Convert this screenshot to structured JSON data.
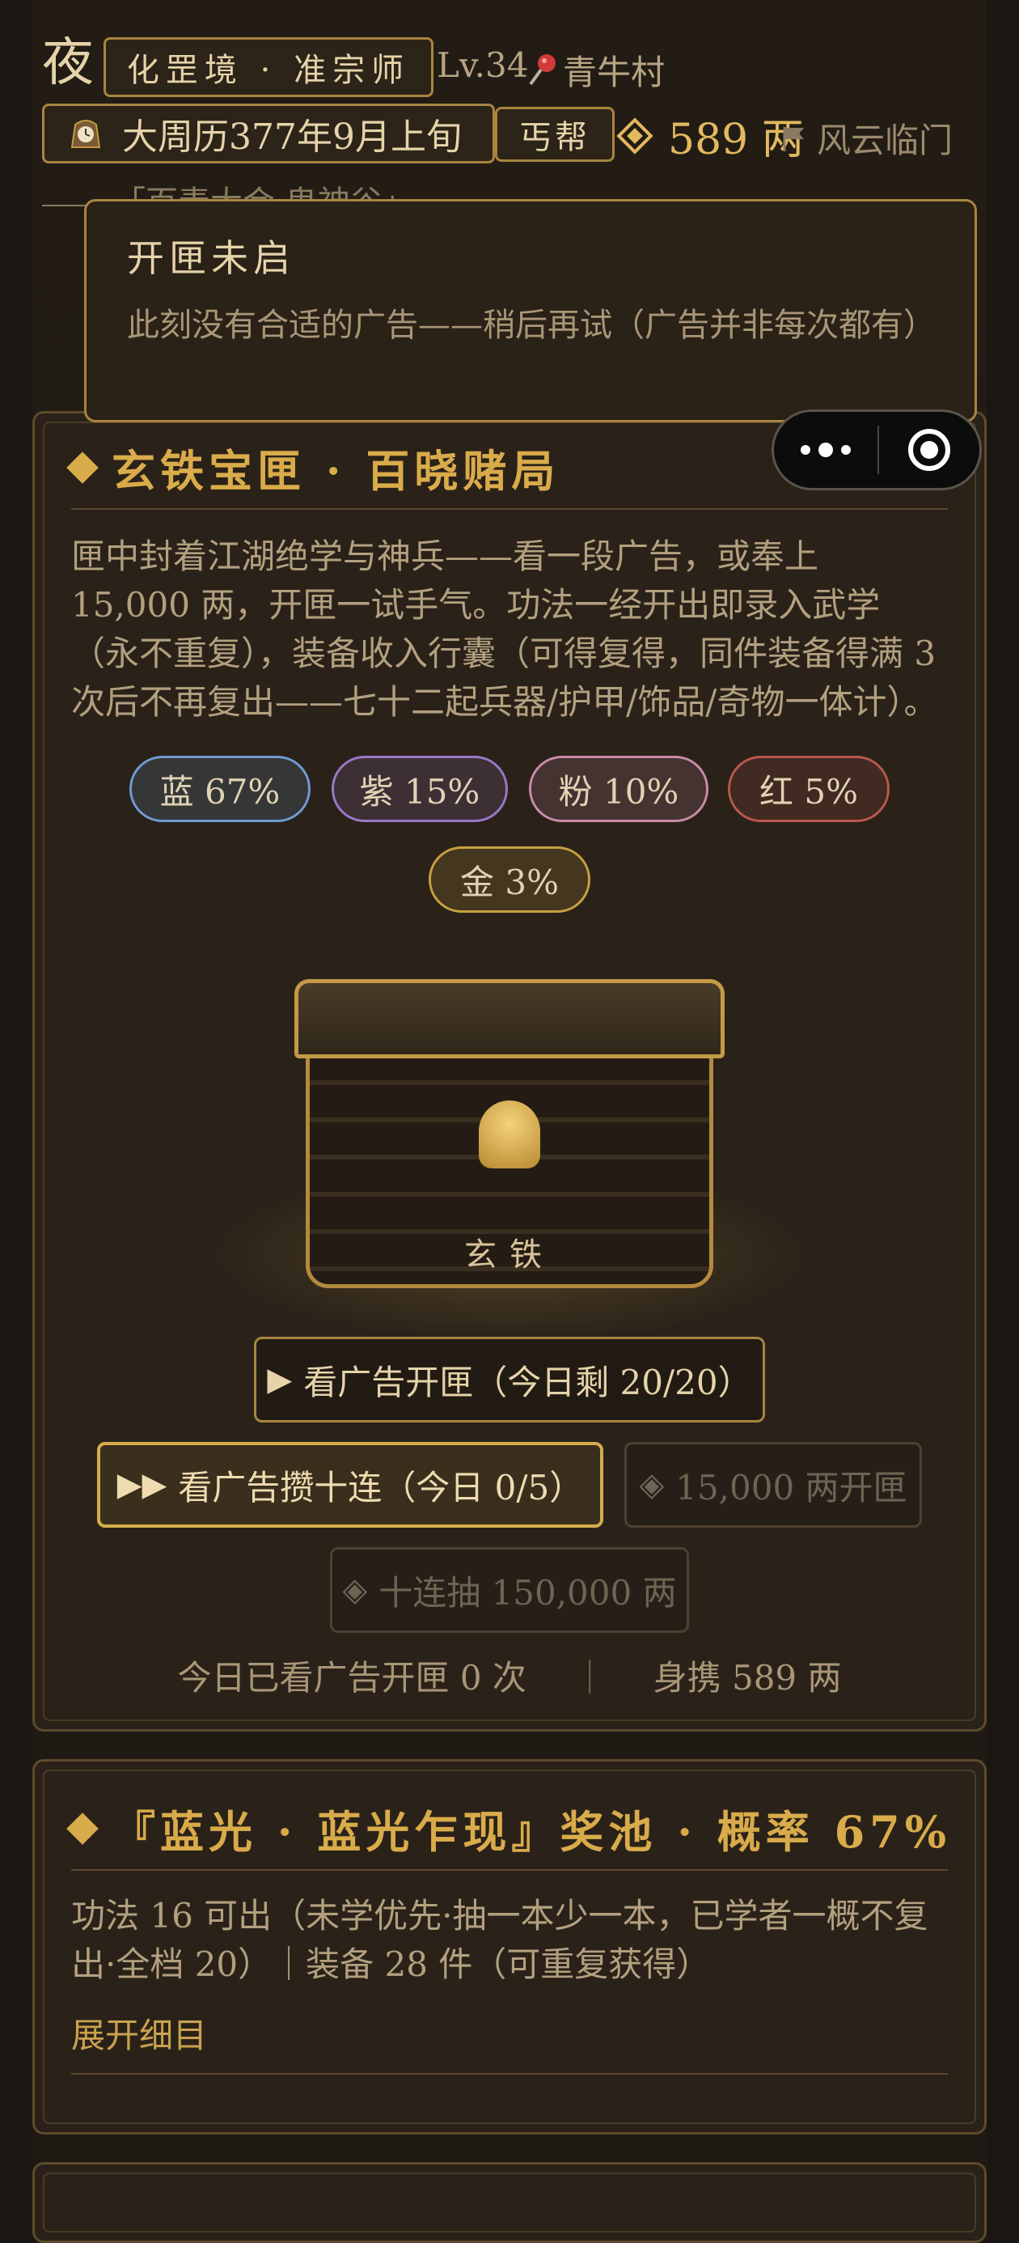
{
  "header": {
    "time_of_day": "夜",
    "realm": "化罡境 · 准宗师",
    "level": "Lv.34",
    "location": "青牛村",
    "date": "大周历377年9月上旬",
    "gang": "丐帮",
    "silver": "589 两",
    "faction": "风云临门",
    "notice": "「百毒大会·鬼神谷」"
  },
  "toast": {
    "title": "开匣未启",
    "message": "此刻没有合适的广告——稍后再试（广告并非每次都有）"
  },
  "capsule": {
    "more_icon": "more-dots-icon",
    "close_icon": "target-circle-icon"
  },
  "chest_panel": {
    "title": "玄铁宝匣 · 百晓赌局",
    "description": "匣中封着江湖绝学与神兵——看一段广告，或奉上 15,000 两，开匣一试手气。功法一经开出即录入武学（永不重复），装备收入行囊（可得复得，同件装备得满 3 次后不再复出——七十二起兵器/护甲/饰品/奇物一体计）。",
    "rates": [
      {
        "label": "蓝 67%",
        "color": "#6f9bd1"
      },
      {
        "label": "紫 15%",
        "color": "#9a78c8"
      },
      {
        "label": "粉 10%",
        "color": "#c98aa8"
      },
      {
        "label": "红 5%",
        "color": "#b8584e"
      },
      {
        "label": "金 3%",
        "color": "#c7a040"
      }
    ],
    "chest_label": "玄铁",
    "btn_watch_ad": "看广告开匣（今日剩 20/20）",
    "btn_ten_ad": "看广告攒十连（今日 0/5）",
    "btn_silver": "15,000 两开匣",
    "btn_ten_silver": "十连抽 150,000 两",
    "stats_ads": "今日已看广告开匣 0 次",
    "stats_sep": "｜",
    "stats_carry": "身携 589 两"
  },
  "pool_panel": {
    "title": "『蓝光 · 蓝光乍现』奖池 · 概率 67%",
    "description": "功法 16 可出（未学优先·抽一本少一本，已学者一概不复出·全档 20）｜装备 28 件（可重复获得）",
    "expand": "展开细目"
  }
}
